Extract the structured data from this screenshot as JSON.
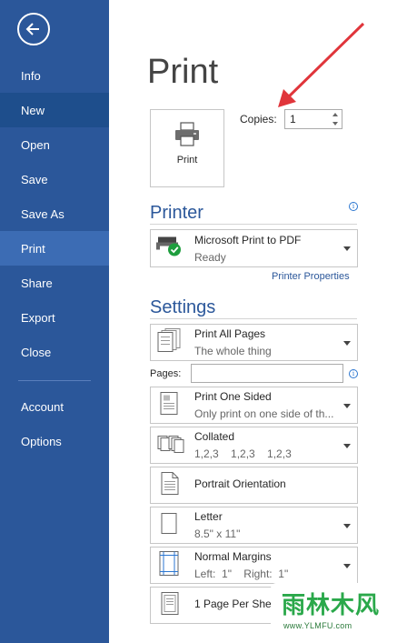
{
  "sidebar": {
    "items": [
      {
        "label": "Info"
      },
      {
        "label": "New"
      },
      {
        "label": "Open"
      },
      {
        "label": "Save"
      },
      {
        "label": "Save As"
      },
      {
        "label": "Print"
      },
      {
        "label": "Share"
      },
      {
        "label": "Export"
      },
      {
        "label": "Close"
      },
      {
        "label": "Account"
      },
      {
        "label": "Options"
      }
    ],
    "active": "Print",
    "bg_color": "#2b579a"
  },
  "main": {
    "title": "Print",
    "print_button_label": "Print",
    "copies_label": "Copies:",
    "copies_value": "1",
    "printer_heading": "Printer",
    "printer": {
      "name": "Microsoft Print to PDF",
      "status": "Ready"
    },
    "printer_properties": "Printer Properties",
    "settings_heading": "Settings",
    "pages_label": "Pages:",
    "pages_value": "",
    "settings": [
      {
        "line1": "Print All Pages",
        "line2": "The whole thing",
        "icon": "pages-icon"
      },
      {
        "line1": "Print One Sided",
        "line2": "Only print on one side of th...",
        "icon": "one-sided-icon"
      },
      {
        "line1": "Collated",
        "line2": "1,2,3    1,2,3    1,2,3",
        "icon": "collated-icon"
      },
      {
        "line1": "Portrait Orientation",
        "line2": "",
        "icon": "portrait-icon"
      },
      {
        "line1": "Letter",
        "line2": "8.5\" x 11\"",
        "icon": "paper-size-icon"
      },
      {
        "line1": "Normal Margins",
        "line2": "Left:  1\"    Right:  1\"",
        "icon": "margins-icon"
      },
      {
        "line1": "1 Page Per Shee",
        "line2": "",
        "icon": "pages-per-sheet-icon"
      }
    ]
  },
  "watermark": {
    "logo": "雨林木风",
    "url": "www.YLMFU.com"
  },
  "colors": {
    "accent": "#2b579a",
    "arrow": "#e0353b",
    "ok": "#1e9e3e"
  }
}
